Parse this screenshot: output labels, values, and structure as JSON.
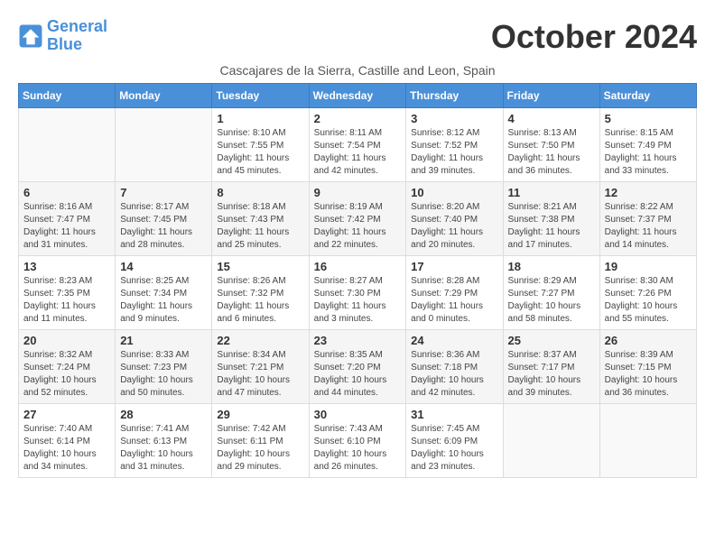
{
  "logo": {
    "line1": "General",
    "line2": "Blue"
  },
  "title": "October 2024",
  "subtitle": "Cascajares de la Sierra, Castille and Leon, Spain",
  "weekdays": [
    "Sunday",
    "Monday",
    "Tuesday",
    "Wednesday",
    "Thursday",
    "Friday",
    "Saturday"
  ],
  "weeks": [
    [
      {
        "day": "",
        "info": ""
      },
      {
        "day": "",
        "info": ""
      },
      {
        "day": "1",
        "info": "Sunrise: 8:10 AM\nSunset: 7:55 PM\nDaylight: 11 hours and 45 minutes."
      },
      {
        "day": "2",
        "info": "Sunrise: 8:11 AM\nSunset: 7:54 PM\nDaylight: 11 hours and 42 minutes."
      },
      {
        "day": "3",
        "info": "Sunrise: 8:12 AM\nSunset: 7:52 PM\nDaylight: 11 hours and 39 minutes."
      },
      {
        "day": "4",
        "info": "Sunrise: 8:13 AM\nSunset: 7:50 PM\nDaylight: 11 hours and 36 minutes."
      },
      {
        "day": "5",
        "info": "Sunrise: 8:15 AM\nSunset: 7:49 PM\nDaylight: 11 hours and 33 minutes."
      }
    ],
    [
      {
        "day": "6",
        "info": "Sunrise: 8:16 AM\nSunset: 7:47 PM\nDaylight: 11 hours and 31 minutes."
      },
      {
        "day": "7",
        "info": "Sunrise: 8:17 AM\nSunset: 7:45 PM\nDaylight: 11 hours and 28 minutes."
      },
      {
        "day": "8",
        "info": "Sunrise: 8:18 AM\nSunset: 7:43 PM\nDaylight: 11 hours and 25 minutes."
      },
      {
        "day": "9",
        "info": "Sunrise: 8:19 AM\nSunset: 7:42 PM\nDaylight: 11 hours and 22 minutes."
      },
      {
        "day": "10",
        "info": "Sunrise: 8:20 AM\nSunset: 7:40 PM\nDaylight: 11 hours and 20 minutes."
      },
      {
        "day": "11",
        "info": "Sunrise: 8:21 AM\nSunset: 7:38 PM\nDaylight: 11 hours and 17 minutes."
      },
      {
        "day": "12",
        "info": "Sunrise: 8:22 AM\nSunset: 7:37 PM\nDaylight: 11 hours and 14 minutes."
      }
    ],
    [
      {
        "day": "13",
        "info": "Sunrise: 8:23 AM\nSunset: 7:35 PM\nDaylight: 11 hours and 11 minutes."
      },
      {
        "day": "14",
        "info": "Sunrise: 8:25 AM\nSunset: 7:34 PM\nDaylight: 11 hours and 9 minutes."
      },
      {
        "day": "15",
        "info": "Sunrise: 8:26 AM\nSunset: 7:32 PM\nDaylight: 11 hours and 6 minutes."
      },
      {
        "day": "16",
        "info": "Sunrise: 8:27 AM\nSunset: 7:30 PM\nDaylight: 11 hours and 3 minutes."
      },
      {
        "day": "17",
        "info": "Sunrise: 8:28 AM\nSunset: 7:29 PM\nDaylight: 11 hours and 0 minutes."
      },
      {
        "day": "18",
        "info": "Sunrise: 8:29 AM\nSunset: 7:27 PM\nDaylight: 10 hours and 58 minutes."
      },
      {
        "day": "19",
        "info": "Sunrise: 8:30 AM\nSunset: 7:26 PM\nDaylight: 10 hours and 55 minutes."
      }
    ],
    [
      {
        "day": "20",
        "info": "Sunrise: 8:32 AM\nSunset: 7:24 PM\nDaylight: 10 hours and 52 minutes."
      },
      {
        "day": "21",
        "info": "Sunrise: 8:33 AM\nSunset: 7:23 PM\nDaylight: 10 hours and 50 minutes."
      },
      {
        "day": "22",
        "info": "Sunrise: 8:34 AM\nSunset: 7:21 PM\nDaylight: 10 hours and 47 minutes."
      },
      {
        "day": "23",
        "info": "Sunrise: 8:35 AM\nSunset: 7:20 PM\nDaylight: 10 hours and 44 minutes."
      },
      {
        "day": "24",
        "info": "Sunrise: 8:36 AM\nSunset: 7:18 PM\nDaylight: 10 hours and 42 minutes."
      },
      {
        "day": "25",
        "info": "Sunrise: 8:37 AM\nSunset: 7:17 PM\nDaylight: 10 hours and 39 minutes."
      },
      {
        "day": "26",
        "info": "Sunrise: 8:39 AM\nSunset: 7:15 PM\nDaylight: 10 hours and 36 minutes."
      }
    ],
    [
      {
        "day": "27",
        "info": "Sunrise: 7:40 AM\nSunset: 6:14 PM\nDaylight: 10 hours and 34 minutes."
      },
      {
        "day": "28",
        "info": "Sunrise: 7:41 AM\nSunset: 6:13 PM\nDaylight: 10 hours and 31 minutes."
      },
      {
        "day": "29",
        "info": "Sunrise: 7:42 AM\nSunset: 6:11 PM\nDaylight: 10 hours and 29 minutes."
      },
      {
        "day": "30",
        "info": "Sunrise: 7:43 AM\nSunset: 6:10 PM\nDaylight: 10 hours and 26 minutes."
      },
      {
        "day": "31",
        "info": "Sunrise: 7:45 AM\nSunset: 6:09 PM\nDaylight: 10 hours and 23 minutes."
      },
      {
        "day": "",
        "info": ""
      },
      {
        "day": "",
        "info": ""
      }
    ]
  ]
}
